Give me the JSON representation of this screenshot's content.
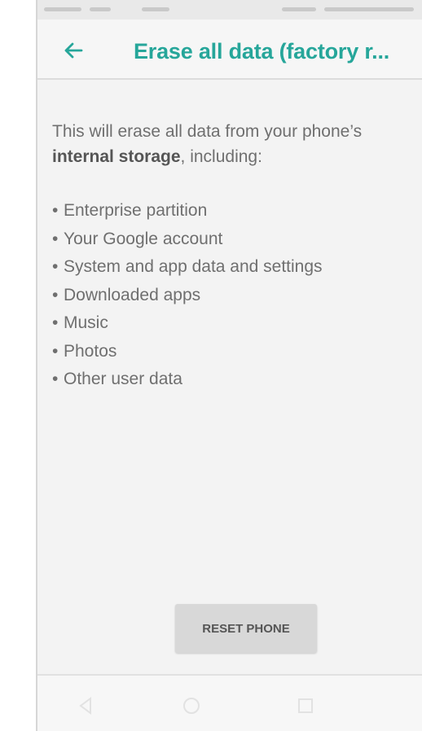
{
  "app_bar": {
    "title": "Erase all data (factory r..."
  },
  "content": {
    "intro_before": "This will erase all data from your phone’s ",
    "intro_bold": "internal storage",
    "intro_after": ", including:",
    "items": [
      "Enterprise partition",
      "Your Google account",
      "System and app data and settings",
      "Downloaded apps",
      "Music",
      "Photos",
      "Other user data"
    ]
  },
  "actions": {
    "reset_label": "RESET PHONE"
  },
  "icons": {
    "back": "arrow-left-icon",
    "nav_back": "nav-back-icon",
    "nav_home": "nav-home-icon",
    "nav_recents": "nav-recents-icon"
  },
  "colors": {
    "accent": "#26a69a",
    "body_text": "#6f6f6f",
    "button_bg": "#d8d8d8"
  }
}
